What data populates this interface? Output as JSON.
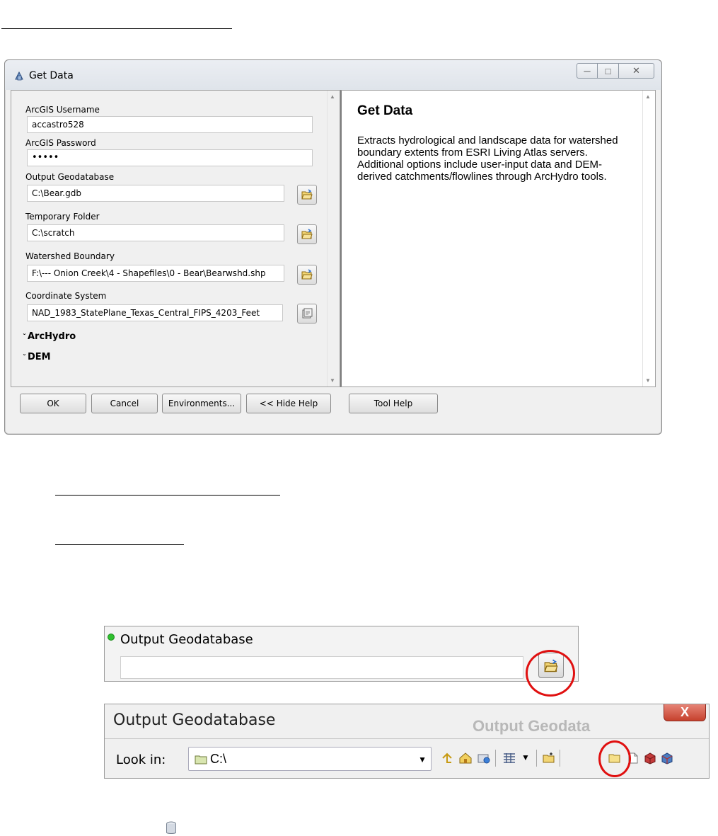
{
  "dialog": {
    "title": "Get Data",
    "fields": [
      {
        "label": "ArcGIS Username",
        "value": "accastro528"
      },
      {
        "label": "ArcGIS Password",
        "value": "•••••"
      },
      {
        "label": "Output Geodatabase",
        "value": "C:\\Bear.gdb"
      },
      {
        "label": "Temporary Folder",
        "value": "C:\\scratch"
      },
      {
        "label": "Watershed Boundary",
        "value": "F:\\--- Onion Creek\\4 - Shapefiles\\0 - Bear\\Bearwshd.shp"
      },
      {
        "label": "Coordinate System",
        "value": "NAD_1983_StatePlane_Texas_Central_FIPS_4203_Feet"
      }
    ],
    "sections": [
      "ArcHydro",
      "DEM"
    ],
    "help": {
      "title": "Get Data",
      "text": "Extracts hydrological and landscape data for watershed boundary extents from ESRI Living Atlas servers. Additional options include user-input data and DEM-derived catchments/flowlines through ArcHydro tools."
    },
    "buttons": {
      "ok": "OK",
      "cancel": "Cancel",
      "environments": "Environments...",
      "hide_help": "<< Hide Help",
      "tool_help": "Tool Help"
    }
  },
  "crop_output": {
    "label": "Output Geodatabase",
    "value": ""
  },
  "crop_browser": {
    "title": "Output Geodatabase",
    "ghost_title": "Output Geodata",
    "close": "X",
    "look_in_label": "Look in:",
    "look_in_value": "C:\\"
  },
  "colors": {
    "highlight_circle": "#e01010",
    "required_dot": "#2fc02f"
  }
}
